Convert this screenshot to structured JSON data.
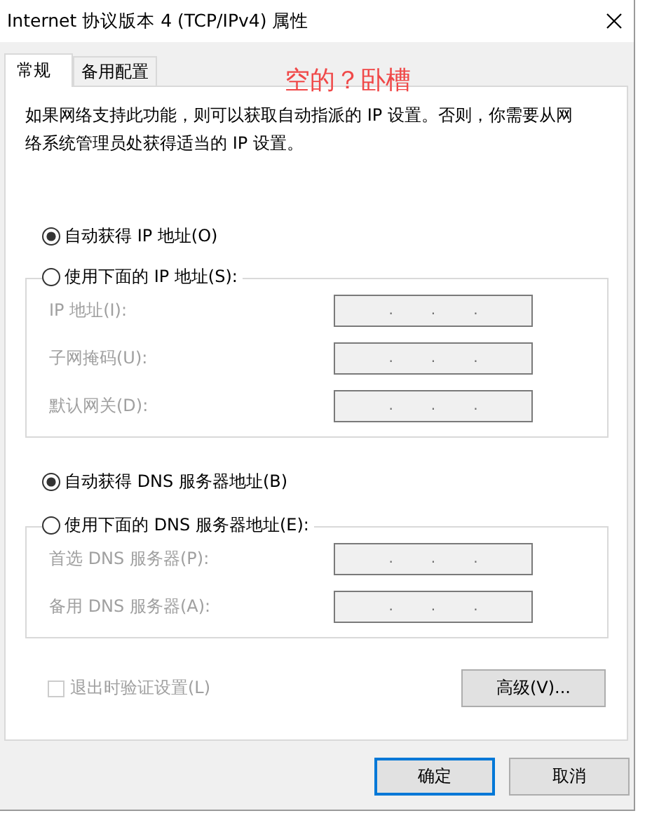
{
  "window": {
    "title": "Internet 协议版本 4 (TCP/IPv4) 属性"
  },
  "tabs": [
    {
      "label": "常规",
      "selected": true
    },
    {
      "label": "备用配置",
      "selected": false
    }
  ],
  "annotation": "空的？卧槽",
  "description": "如果网络支持此功能，则可以获取自动指派的 IP 设置。否则，你需要从网络系统管理员处获得适当的 IP 设置。",
  "ip_section": {
    "auto_option": {
      "label": "自动获得 IP 地址(O)",
      "selected": true
    },
    "manual_option": {
      "label": "使用下面的 IP 地址(S):",
      "selected": false
    },
    "fields": [
      {
        "label": "IP 地址(I):",
        "separator": ".",
        "disabled": true
      },
      {
        "label": "子网掩码(U):",
        "separator": ".",
        "disabled": true
      },
      {
        "label": "默认网关(D):",
        "separator": ".",
        "disabled": true
      }
    ]
  },
  "dns_section": {
    "auto_option": {
      "label": "自动获得 DNS 服务器地址(B)",
      "selected": true
    },
    "manual_option": {
      "label": "使用下面的 DNS 服务器地址(E):",
      "selected": false
    },
    "fields": [
      {
        "label": "首选 DNS 服务器(P):",
        "separator": ".",
        "disabled": true
      },
      {
        "label": "备用 DNS 服务器(A):",
        "separator": ".",
        "disabled": true
      }
    ]
  },
  "validate_checkbox": {
    "label": "退出时验证设置(L)",
    "checked": false,
    "disabled": true
  },
  "advanced_button": {
    "label": "高级(V)..."
  },
  "buttons": [
    {
      "label": "确定",
      "default": true
    },
    {
      "label": "取消",
      "default": false
    }
  ]
}
